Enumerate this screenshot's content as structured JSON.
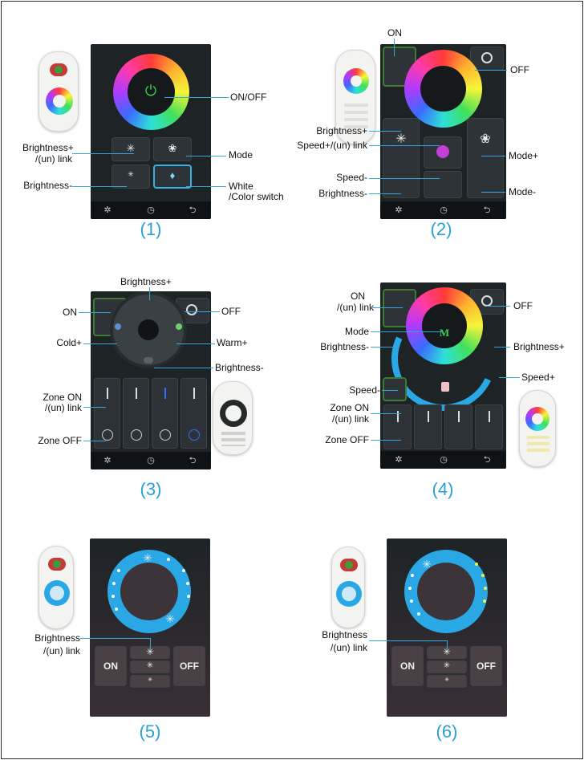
{
  "panels": {
    "p1": {
      "caption": "(1)",
      "labels": {
        "on_off": "ON/OFF",
        "brightness_plus_1": "Brightness+",
        "brightness_plus_2": "/(un) link",
        "mode": "Mode",
        "brightness_minus": "Brightness-",
        "white_color_1": "White",
        "white_color_2": "/Color switch"
      }
    },
    "p2": {
      "caption": "(2)",
      "labels": {
        "on": "ON",
        "off": "OFF",
        "brightness_plus": "Brightness+",
        "mode_plus": "Mode+",
        "speed_plus_link": "Speed+/(un) link",
        "speed_minus": "Speed-",
        "brightness_minus": "Brightness-",
        "mode_minus": "Mode-"
      }
    },
    "p3": {
      "caption": "(3)",
      "labels": {
        "brightness_plus": "Brightness+",
        "on": "ON",
        "off": "OFF",
        "cold_plus": "Cold+",
        "warm_plus": "Warm+",
        "brightness_minus": "Brightness-",
        "zone_on_1": "Zone ON",
        "zone_on_2": "/(un) link",
        "zone_off": "Zone OFF"
      }
    },
    "p4": {
      "caption": "(4)",
      "labels": {
        "on_1": "ON",
        "on_2": "/(un) link",
        "off": "OFF",
        "mode": "Mode",
        "brightness_minus": "Brightness-",
        "brightness_plus": "Brightness+",
        "speed_minus": "Speed-",
        "speed_plus": "Speed+",
        "zone_on_1": "Zone ON",
        "zone_on_2": "/(un) link",
        "zone_off": "Zone OFF"
      },
      "mode_glyph": "M"
    },
    "p5": {
      "caption": "(5)",
      "labels": {
        "brightness_1": "Brightness",
        "brightness_2": "/(un) link"
      },
      "on_button": "ON",
      "off_button": "OFF"
    },
    "p6": {
      "caption": "(6)",
      "labels": {
        "brightness_1": "Brightness",
        "brightness_2": "/(un) link"
      },
      "on_button": "ON",
      "off_button": "OFF"
    }
  },
  "icons": {
    "power": "⏻",
    "sun": "✳",
    "bulb": "♦",
    "flower": "❀",
    "nav_back": "⮌",
    "nav_clock": "◷",
    "nav_fan": "✲"
  },
  "colors": {
    "accent_line": "#34a8de",
    "caption": "#2b9fd8",
    "power_green": "#3bd14d",
    "ring_blue": "#2aa8e6"
  }
}
